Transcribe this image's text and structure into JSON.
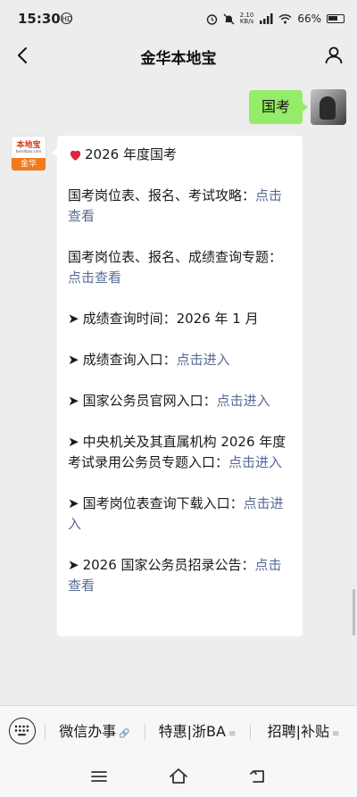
{
  "status_bar": {
    "time": "15:30",
    "hd_badge": "HD",
    "net_speed_value": "2.10",
    "net_speed_unit": "KB/s",
    "network": "5G HD",
    "battery": "66%"
  },
  "header": {
    "title": "金华本地宝"
  },
  "outgoing": {
    "text": "国考"
  },
  "bot": {
    "logo_top": "本地宝",
    "logo_mid": "bendibao.com",
    "logo_bottom": "金华"
  },
  "message": {
    "heading": "2026 年度国考",
    "items": [
      {
        "arrow": "",
        "text": "国考岗位表、报名、考试攻略：",
        "link": "点击查看"
      },
      {
        "arrow": "",
        "text": "国考岗位表、报名、成绩查询专题：",
        "link": "点击查看"
      },
      {
        "arrow": "➤",
        "text": "成绩查询时间：2026 年 1 月",
        "link": ""
      },
      {
        "arrow": "➤",
        "text": "成绩查询入口：",
        "link": "点击进入"
      },
      {
        "arrow": "➤",
        "text": "国家公务员官网入口：",
        "link": "点击进入"
      },
      {
        "arrow": "➤",
        "text": "中央机关及其直属机构 2026 年度考试录用公务员专题入口：",
        "link": "点击进入"
      },
      {
        "arrow": "➤",
        "text": "国考岗位表查询下载入口：",
        "link": "点击进入"
      },
      {
        "arrow": "➤",
        "text": "2026 国家公务员招录公告：",
        "link": "点击查看"
      }
    ]
  },
  "menu": {
    "item1": "微信办事",
    "item1_sub": "🔗",
    "item2": "特惠|浙BA",
    "item2_sub": "≡",
    "item3": "招聘|补贴",
    "item3_sub": "≡"
  },
  "colors": {
    "link": "#576b95",
    "bubble_out": "#95ec69",
    "background": "#ededed"
  }
}
